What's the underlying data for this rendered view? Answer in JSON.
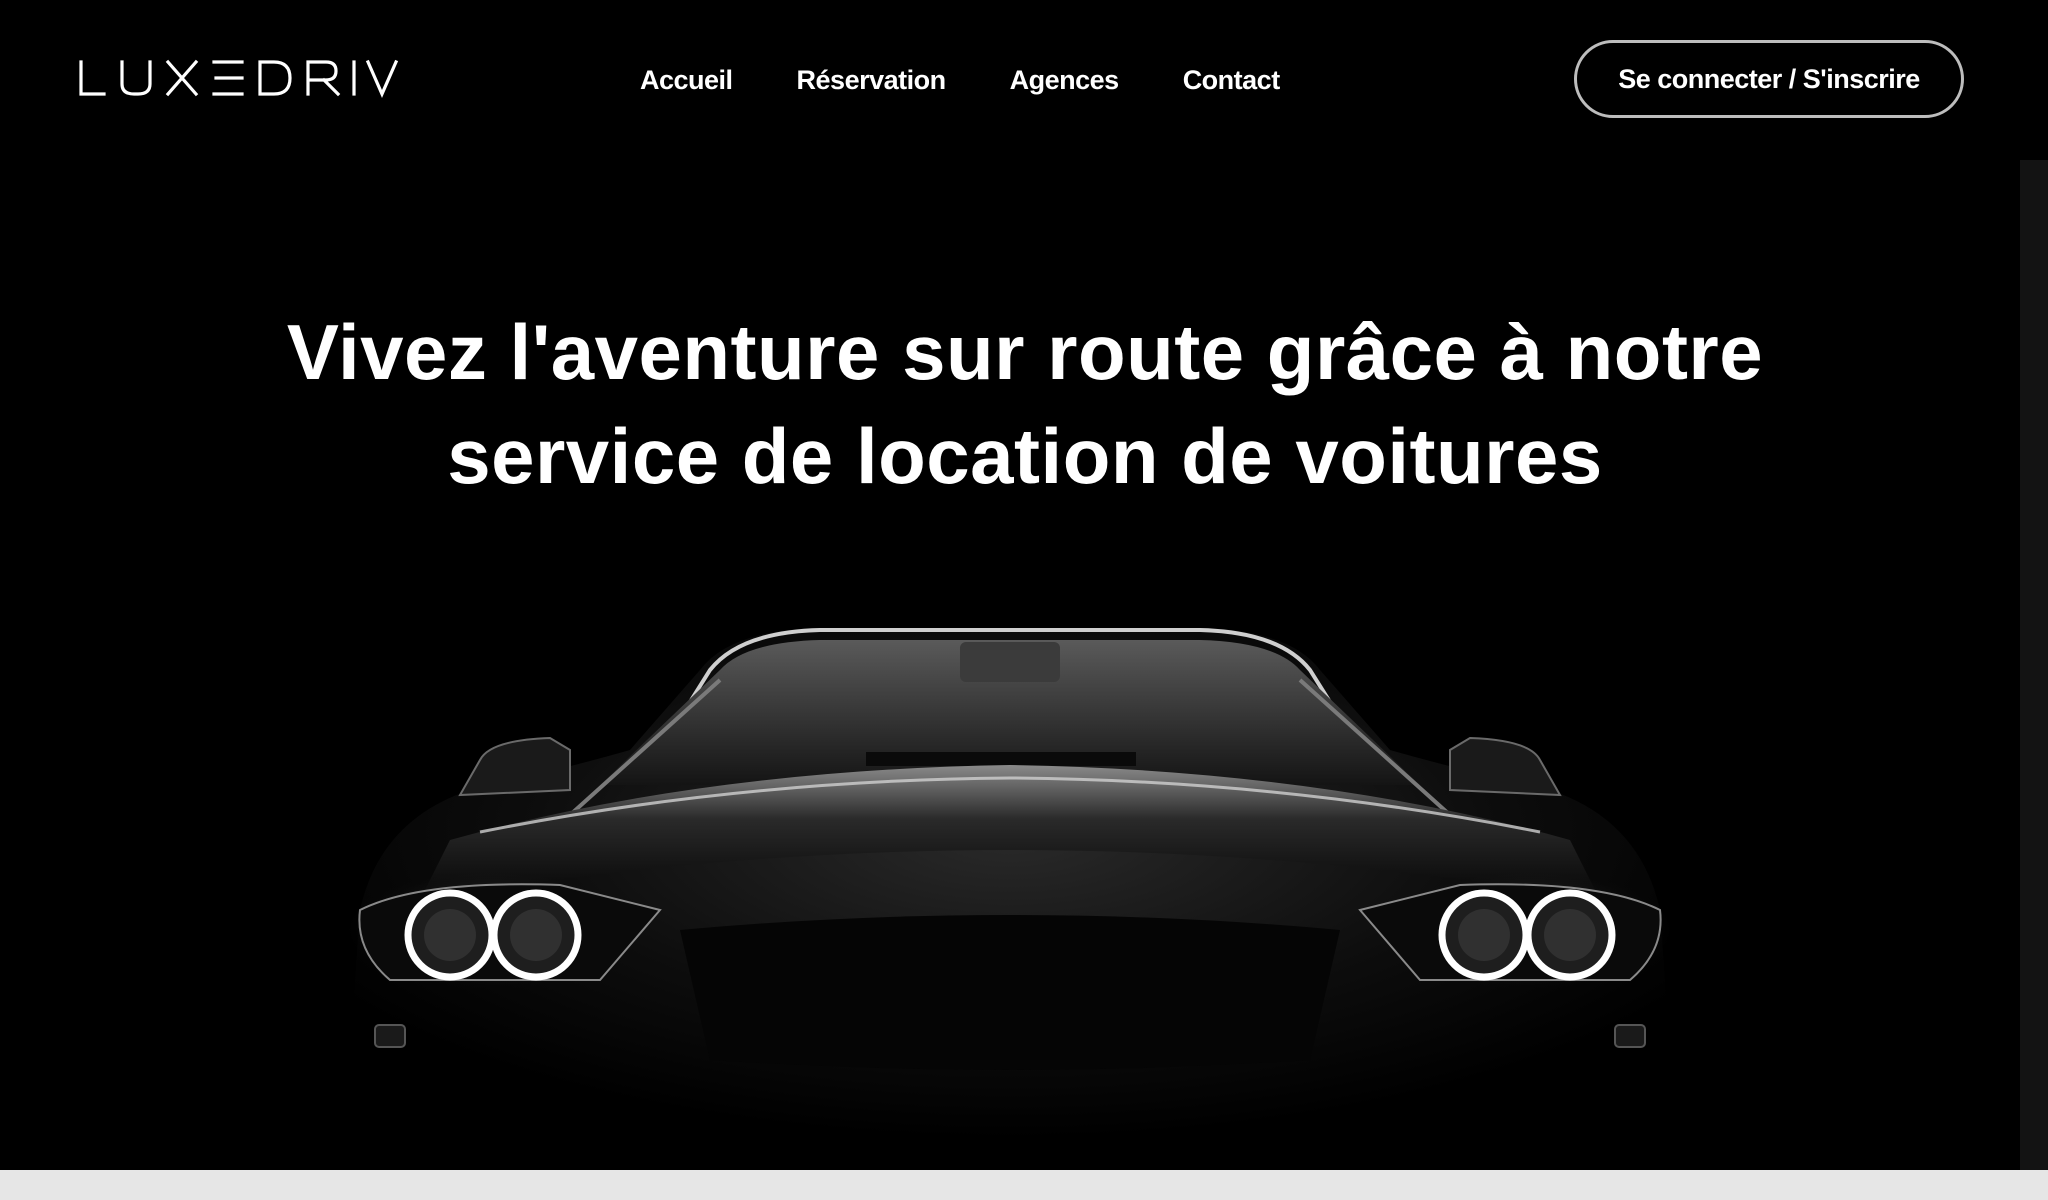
{
  "brand": {
    "name": "LUXEDRIVE"
  },
  "nav": {
    "items": [
      {
        "label": "Accueil"
      },
      {
        "label": "Réservation"
      },
      {
        "label": "Agences"
      },
      {
        "label": "Contact"
      }
    ]
  },
  "auth": {
    "label": "Se connecter / S'inscrire"
  },
  "hero": {
    "title_line1": "Vivez l'aventure sur route grâce à notre",
    "title_line2": "service de location de voitures",
    "image_alt": "car-front-headlights-image"
  },
  "colors": {
    "background": "#000000",
    "text": "#ffffff",
    "button_border": "#bdbdbd",
    "footer_strip": "#e6e6e6"
  }
}
